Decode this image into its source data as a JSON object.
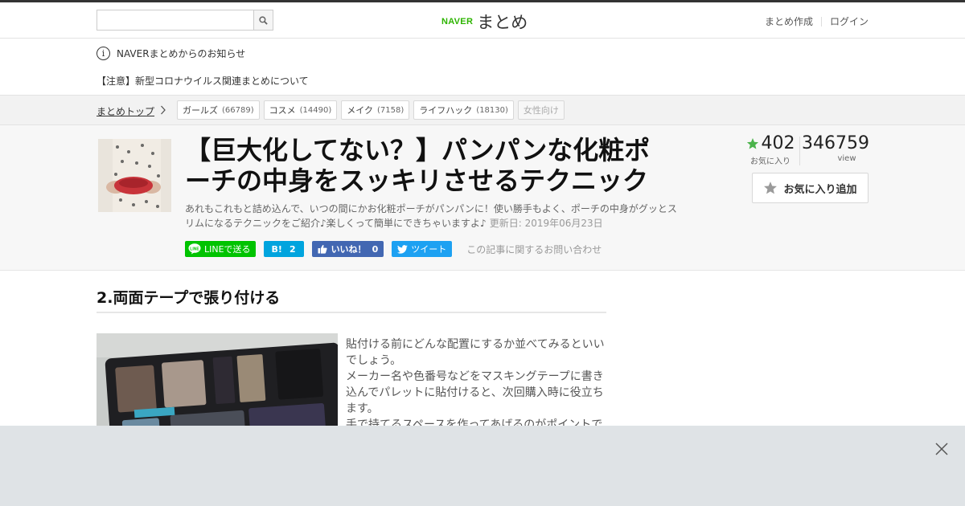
{
  "header": {
    "search": {
      "value": "",
      "placeholder": ""
    },
    "logo": {
      "naver": "NAVER",
      "matome": "まとめ"
    },
    "links": {
      "create": "まとめ作成",
      "login": "ログイン"
    }
  },
  "notice": {
    "title": "NAVERまとめからのお知らせ",
    "link": "【注意】新型コロナウイルス関連まとめについて"
  },
  "breadcrumb": {
    "top": "まとめトップ"
  },
  "tags": [
    {
      "label": "ガールズ",
      "count": "(66789)"
    },
    {
      "label": "コスメ",
      "count": "(14490)"
    },
    {
      "label": "メイク",
      "count": "(7158)"
    },
    {
      "label": "ライフハック",
      "count": "(18130)"
    },
    {
      "label": "女性向け",
      "count": ""
    }
  ],
  "article": {
    "title": "【巨大化してない？】パンパンな化粧ポーチの中身をスッキリさせるテクニック",
    "description": "あれもこれもと詰め込んで、いつの間にかお化粧ポーチがパンパンに！使い勝手もよく、ポーチの中身がグッとスリムになるテクニックをご紹介♪楽しくって簡単にできちゃいますよ♪",
    "updated": "更新日: 2019年06月23日",
    "stats": {
      "favorites": "402",
      "favorites_label": "お気に入り",
      "views": "346759",
      "views_label": "view"
    },
    "fav_button": "お気に入り追加",
    "share": {
      "line": "LINEで送る",
      "hatena_icon": "B!",
      "hatena_count": "2",
      "fb_label": "いいね！",
      "fb_count": "0",
      "tweet": "ツイート"
    },
    "contact": "この記事に関するお問い合わせ"
  },
  "section": {
    "title": "2.両面テープで張り付ける",
    "body": "貼付ける前にどんな配置にするか並べてみるといいでしょう。\nメーカー名や色番号などをマスキングテープに書き込んでパレットに貼付けると、次回購入時に役立ちます。\n手で持てるスペースを作ってあげるのがポイントで"
  },
  "colors": {
    "naver_green": "#2db400",
    "star_green": "#4bb34b",
    "line_green": "#00c300",
    "hatena_blue": "#00a4de",
    "fb_blue": "#4267b2",
    "twitter_blue": "#1da1f2",
    "ad_overlay": "#dfe3e6"
  },
  "icons": [
    "search-icon",
    "info-icon",
    "chevron-right-icon",
    "star-icon",
    "line-icon",
    "facebook-like-icon",
    "twitter-bird-icon",
    "close-icon"
  ]
}
